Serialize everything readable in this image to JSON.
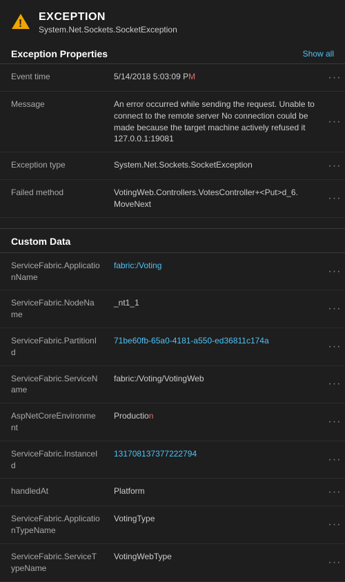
{
  "header": {
    "icon_alt": "warning-triangle-icon",
    "title": "EXCEPTION",
    "subtitle": "System.Net.Sockets.SocketException"
  },
  "exception_properties": {
    "section_title": "Exception Properties",
    "show_all_label": "Show all",
    "rows": [
      {
        "key": "Event time",
        "value_prefix": "5/14/2018 5:03:09 P",
        "value_highlight": "M",
        "value_suffix": ""
      },
      {
        "key": "Message",
        "value": "An error occurred while sending the request. Unable to connect to the remote server No connection could be made because the target machine actively refused it 127.0.0.1:19081"
      },
      {
        "key": "Exception type",
        "value": "System.Net.Sockets.SocketException"
      },
      {
        "key": "Failed method",
        "value_prefix": "VotingWeb.Controllers.VotesController+<Put>d_6.",
        "value_highlight": "",
        "value_suffix": "MoveNext",
        "full_value": "VotingWeb.Controllers.VotesController+<Put>d_6.MoveNext"
      }
    ]
  },
  "custom_data": {
    "section_title": "Custom Data",
    "rows": [
      {
        "key": "ServiceFabric.ApplicationName",
        "value_prefix": "fabric:/Voting",
        "value_highlight": "",
        "link": true
      },
      {
        "key": "ServiceFabric.NodeName",
        "value": "_nt1_1"
      },
      {
        "key": "ServiceFabric.PartitionId",
        "value": "71be60fb-65a0-4181-a550-ed36811c174a",
        "link": true
      },
      {
        "key": "ServiceFabric.ServiceName",
        "value": "fabric:/Voting/VotingWeb"
      },
      {
        "key": "AspNetCoreEnvironment",
        "value_prefix": "Productio",
        "value_highlight": "n",
        "value_suffix": ""
      },
      {
        "key": "ServiceFabric.InstanceId",
        "value": "131708137377222794",
        "link": true
      },
      {
        "key": "handledAt",
        "value": "Platform"
      },
      {
        "key": "ServiceFabric.ApplicationTypeName",
        "value": "VotingType"
      },
      {
        "key": "ServiceFabric.ServiceTypeName",
        "value": "VotingWebType"
      }
    ]
  },
  "icons": {
    "ellipsis": "···",
    "warning": "⚠"
  }
}
